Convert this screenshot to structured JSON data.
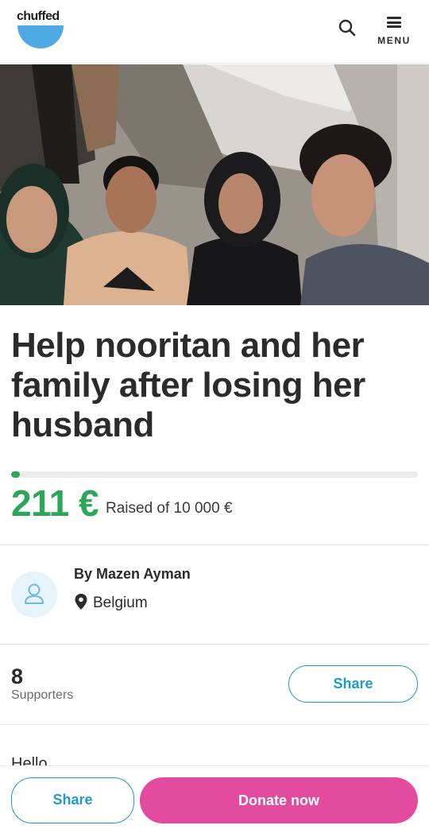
{
  "header": {
    "logo_text": "chuffed",
    "search_icon": "search-icon",
    "menu_icon": "hamburger-menu-icon",
    "menu_label": "MENU"
  },
  "hero": {
    "image": "photo-of-family-in-damaged-room"
  },
  "campaign": {
    "title": "Help nooritan and her family after losing her husband",
    "raised": "211 €",
    "raised_of": "Raised of 10 000 €",
    "progress_fraction": 0.0211
  },
  "organizer": {
    "avatar_icon": "user-icon",
    "by_line": "By Mazen Ayman",
    "location_icon": "map-pin-icon",
    "location": "Belgium"
  },
  "supporters": {
    "count": "8",
    "label": "Supporters",
    "share_label": "Share"
  },
  "story": {
    "preview_text": "Hello"
  },
  "bottom_bar": {
    "share_label": "Share",
    "donate_label": "Donate now"
  },
  "colors": {
    "brand_blue": "#4fa9e2",
    "progress_green": "#2ea65a",
    "share_blue": "#1f9ac9",
    "donate_pink": "#e34b9e"
  }
}
